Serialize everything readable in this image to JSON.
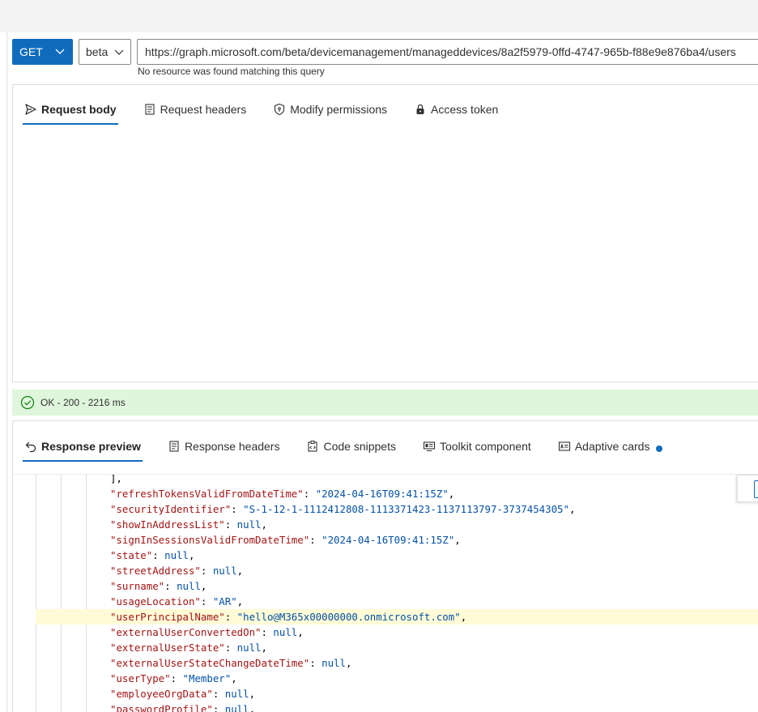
{
  "request": {
    "method": "GET",
    "version": "beta",
    "url": "https://graph.microsoft.com/beta/devicemanagement/manageddevices/8a2f5979-0ffd-4747-965b-f88e9e876ba4/users",
    "error": "No resource was found matching this query"
  },
  "request_tabs": [
    {
      "label": "Request body",
      "icon": "send-icon",
      "active": true
    },
    {
      "label": "Request headers",
      "icon": "headers-icon"
    },
    {
      "label": "Modify permissions",
      "icon": "shield-icon"
    },
    {
      "label": "Access token",
      "icon": "lock-icon"
    }
  ],
  "status": {
    "text": "OK - 200 - 2216 ms",
    "icon": "check-circle-icon",
    "color": "#dff6dd"
  },
  "response_tabs": [
    {
      "label": "Response preview",
      "icon": "back-arrow-icon",
      "active": true
    },
    {
      "label": "Response headers",
      "icon": "headers-icon"
    },
    {
      "label": "Code snippets",
      "icon": "snippet-icon"
    },
    {
      "label": "Toolkit component",
      "icon": "toolkit-icon"
    },
    {
      "label": "Adaptive cards",
      "icon": "card-icon",
      "badge": true
    }
  ],
  "response_lines": [
    {
      "punct": "],"
    },
    {
      "key": "\"refreshTokensValidFromDateTime\"",
      "sep": ": ",
      "value": "\"2024-04-16T09:41:15Z\"",
      "end": ","
    },
    {
      "key": "\"securityIdentifier\"",
      "sep": ": ",
      "value": "\"S-1-12-1-1112412808-1113371423-1137113797-3737454305\"",
      "end": ","
    },
    {
      "key": "\"showInAddressList\"",
      "sep": ": ",
      "value": "null",
      "end": ","
    },
    {
      "key": "\"signInSessionsValidFromDateTime\"",
      "sep": ": ",
      "value": "\"2024-04-16T09:41:15Z\"",
      "end": ","
    },
    {
      "key": "\"state\"",
      "sep": ": ",
      "value": "null",
      "end": ","
    },
    {
      "key": "\"streetAddress\"",
      "sep": ": ",
      "value": "null",
      "end": ","
    },
    {
      "key": "\"surname\"",
      "sep": ": ",
      "value": "null",
      "end": ","
    },
    {
      "key": "\"usageLocation\"",
      "sep": ": ",
      "value": "\"AR\"",
      "end": ","
    },
    {
      "key": "\"userPrincipalName\"",
      "sep": ": ",
      "value": "\"hello@M365x00000000.onmicrosoft.com\"",
      "end": ","
    },
    {
      "key": "\"externalUserConvertedOn\"",
      "sep": ": ",
      "value": "null",
      "end": ","
    },
    {
      "key": "\"externalUserState\"",
      "sep": ": ",
      "value": "null",
      "end": ","
    },
    {
      "key": "\"externalUserStateChangeDateTime\"",
      "sep": ": ",
      "value": "null",
      "end": ","
    },
    {
      "key": "\"userType\"",
      "sep": ": ",
      "value": "\"Member\"",
      "end": ","
    },
    {
      "key": "\"employeeOrgData\"",
      "sep": ": ",
      "value": "null",
      "end": ","
    },
    {
      "key": "\"passwordProfile\"",
      "sep": ": ",
      "value": "null",
      "end": ","
    }
  ]
}
